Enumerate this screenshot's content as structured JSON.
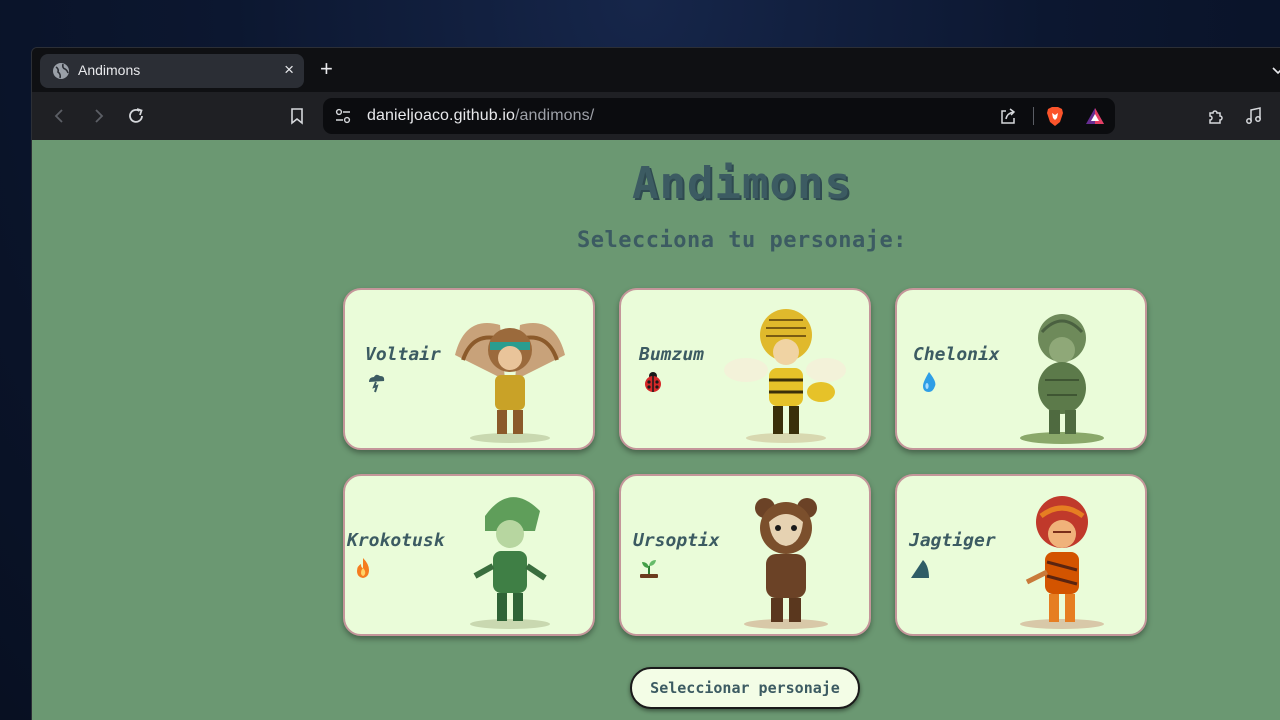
{
  "browser": {
    "tab_title": "Andimons",
    "tab_close": "×",
    "new_tab": "+",
    "url_host": "danieljoaco.github.io",
    "url_path": "/andimons/"
  },
  "page": {
    "title": "Andimons",
    "subtitle": "Selecciona tu personaje:",
    "button_label": "Seleccionar personaje"
  },
  "characters": [
    {
      "name": "Voltair",
      "element_icon": "storm-cloud-icon",
      "portrait": "winged-eagle-warrior"
    },
    {
      "name": "Bumzum",
      "element_icon": "ladybug-icon",
      "portrait": "bee-warrior"
    },
    {
      "name": "Chelonix",
      "element_icon": "water-drop-icon",
      "portrait": "turtle-warrior"
    },
    {
      "name": "Krokotusk",
      "element_icon": "fire-icon",
      "portrait": "crocodile-warrior"
    },
    {
      "name": "Ursoptix",
      "element_icon": "seedling-icon",
      "portrait": "bear-warrior"
    },
    {
      "name": "Jagtiger",
      "element_icon": "rock-icon",
      "portrait": "tiger-warrior"
    }
  ],
  "colors": {
    "page_bg": "#6b9872",
    "card_bg": "#eafcd9",
    "card_border": "#c4969a",
    "heading": "#3c5b62"
  }
}
